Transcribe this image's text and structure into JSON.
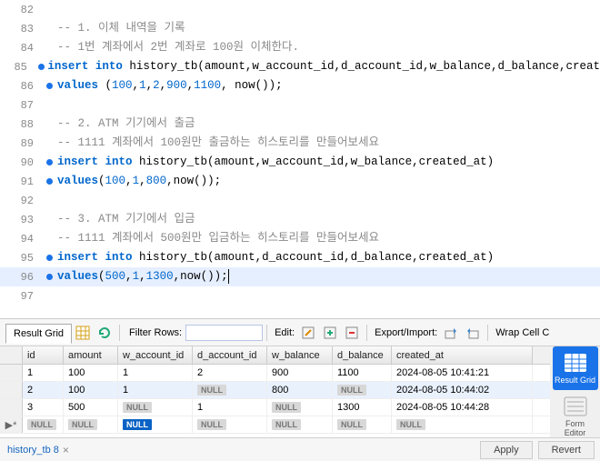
{
  "editor": {
    "lines": [
      {
        "num": 82,
        "marker": false,
        "segs": []
      },
      {
        "num": 83,
        "marker": false,
        "segs": [
          {
            "t": "-- 1. 이체 내역을 기록",
            "c": "c-comment"
          }
        ]
      },
      {
        "num": 84,
        "marker": false,
        "segs": [
          {
            "t": "-- 1번 계좌에서 2번 계좌로 100원 이체한다.",
            "c": "c-comment"
          }
        ]
      },
      {
        "num": 85,
        "marker": true,
        "segs": [
          {
            "t": "insert",
            "c": "c-kw"
          },
          {
            "t": " ",
            "c": ""
          },
          {
            "t": "into",
            "c": "c-kw"
          },
          {
            "t": " history_tb(amount,w_account_id,d_account_id,w_balance,d_balance,creat",
            "c": "c-id"
          }
        ]
      },
      {
        "num": 86,
        "marker": true,
        "segs": [
          {
            "t": "values",
            "c": "c-kw"
          },
          {
            "t": " (",
            "c": ""
          },
          {
            "t": "100",
            "c": "c-num"
          },
          {
            "t": ",",
            "c": ""
          },
          {
            "t": "1",
            "c": "c-num"
          },
          {
            "t": ",",
            "c": ""
          },
          {
            "t": "2",
            "c": "c-num"
          },
          {
            "t": ",",
            "c": ""
          },
          {
            "t": "900",
            "c": "c-num"
          },
          {
            "t": ",",
            "c": ""
          },
          {
            "t": "1100",
            "c": "c-num"
          },
          {
            "t": ", now());",
            "c": ""
          }
        ]
      },
      {
        "num": 87,
        "marker": false,
        "segs": []
      },
      {
        "num": 88,
        "marker": false,
        "segs": [
          {
            "t": "-- 2. ATM 기기에서 출금",
            "c": "c-comment"
          }
        ]
      },
      {
        "num": 89,
        "marker": false,
        "segs": [
          {
            "t": "-- 1111 계좌에서 100원만 출금하는 히스토리를 만들어보세요",
            "c": "c-comment"
          }
        ]
      },
      {
        "num": 90,
        "marker": true,
        "segs": [
          {
            "t": "insert",
            "c": "c-kw"
          },
          {
            "t": " ",
            "c": ""
          },
          {
            "t": "into",
            "c": "c-kw"
          },
          {
            "t": " history_tb(amount,w_account_id,w_balance,created_at)",
            "c": "c-id"
          }
        ]
      },
      {
        "num": 91,
        "marker": true,
        "segs": [
          {
            "t": "values",
            "c": "c-kw"
          },
          {
            "t": "(",
            "c": ""
          },
          {
            "t": "100",
            "c": "c-num"
          },
          {
            "t": ",",
            "c": ""
          },
          {
            "t": "1",
            "c": "c-num"
          },
          {
            "t": ",",
            "c": ""
          },
          {
            "t": "800",
            "c": "c-num"
          },
          {
            "t": ",now());",
            "c": ""
          }
        ]
      },
      {
        "num": 92,
        "marker": false,
        "segs": []
      },
      {
        "num": 93,
        "marker": false,
        "segs": [
          {
            "t": "-- 3. ATM 기기에서 입금",
            "c": "c-comment"
          }
        ]
      },
      {
        "num": 94,
        "marker": false,
        "segs": [
          {
            "t": "-- 1111 계좌에서 500원만 입금하는 히스토리를 만들어보세요",
            "c": "c-comment"
          }
        ]
      },
      {
        "num": 95,
        "marker": true,
        "segs": [
          {
            "t": "insert",
            "c": "c-kw"
          },
          {
            "t": " ",
            "c": ""
          },
          {
            "t": "into",
            "c": "c-kw"
          },
          {
            "t": " history_tb(amount,d_account_id,d_balance,created_at)",
            "c": "c-id"
          }
        ]
      },
      {
        "num": 96,
        "marker": true,
        "highlight": true,
        "segs": [
          {
            "t": "values",
            "c": "c-kw"
          },
          {
            "t": "(",
            "c": ""
          },
          {
            "t": "500",
            "c": "c-num"
          },
          {
            "t": ",",
            "c": ""
          },
          {
            "t": "1",
            "c": "c-num"
          },
          {
            "t": ",",
            "c": ""
          },
          {
            "t": "1300",
            "c": "c-num"
          },
          {
            "t": ",now());",
            "c": ""
          }
        ],
        "cursor": true
      },
      {
        "num": 97,
        "marker": false,
        "segs": []
      }
    ]
  },
  "toolbar": {
    "result_grid": "Result Grid",
    "filter_label": "Filter Rows:",
    "filter_value": "",
    "edit_label": "Edit:",
    "export_label": "Export/Import:",
    "wrap_label": "Wrap Cell C"
  },
  "grid": {
    "headers": [
      "id",
      "amount",
      "w_account_id",
      "d_account_id",
      "w_balance",
      "d_balance",
      "created_at"
    ],
    "rows": [
      {
        "sel": false,
        "cells": [
          "1",
          "100",
          "1",
          "2",
          "900",
          "1100",
          "2024-08-05 10:41:21"
        ]
      },
      {
        "sel": true,
        "cells": [
          "2",
          "100",
          "1",
          null,
          "800",
          null,
          "2024-08-05 10:44:02"
        ]
      },
      {
        "sel": false,
        "cells": [
          "3",
          "500",
          null,
          "1",
          null,
          "1300",
          "2024-08-05 10:44:28"
        ]
      },
      {
        "sel": false,
        "new": true,
        "cells": [
          null,
          null,
          null,
          null,
          null,
          null,
          null
        ],
        "selnull": 2
      }
    ],
    "new_marker": "▶*"
  },
  "side": {
    "result_grid": "Result Grid",
    "form_editor": "Form Editor"
  },
  "bottom": {
    "tab": "history_tb 8",
    "apply": "Apply",
    "revert": "Revert"
  },
  "null_text": "NULL"
}
